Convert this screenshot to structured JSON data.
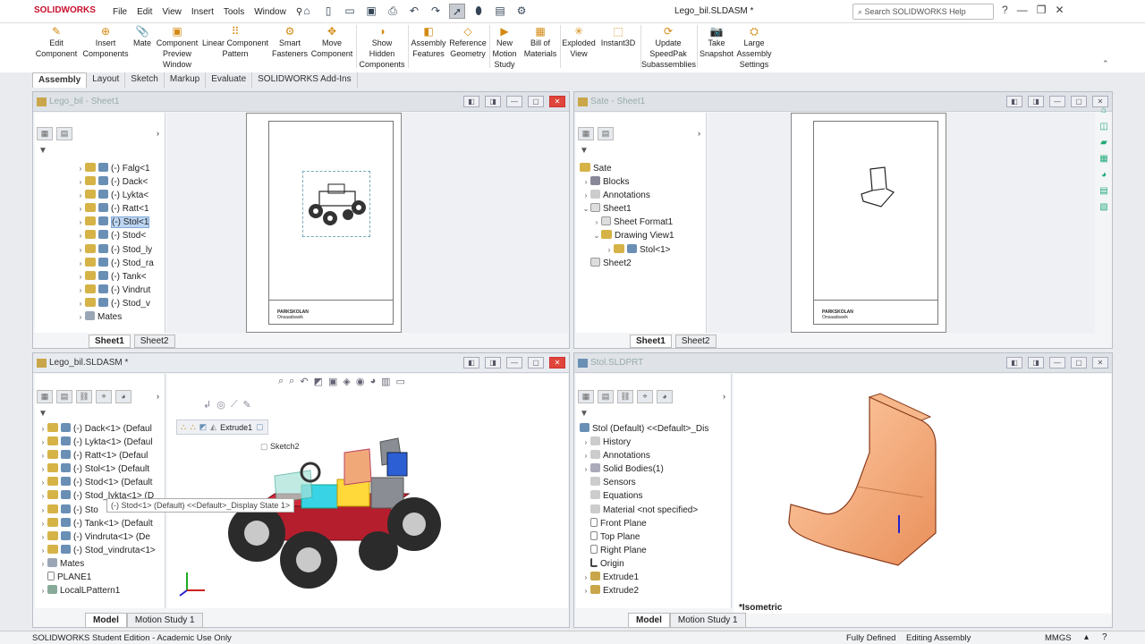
{
  "app": {
    "logo": "SOLIDWORKS",
    "doc_title": "Lego_bil.SLDASM *",
    "search_placeholder": "Search SOLIDWORKS Help"
  },
  "menu": [
    "File",
    "Edit",
    "View",
    "Insert",
    "Tools",
    "Window"
  ],
  "ribbon": [
    {
      "label": "Edit\nComponent",
      "icon": "edit-component-icon"
    },
    {
      "label": "Insert\nComponents",
      "icon": "insert-components-icon"
    },
    {
      "label": "Mate",
      "icon": "mate-icon"
    },
    {
      "label": "Component\nPreview\nWindow",
      "icon": "component-preview-icon"
    },
    {
      "label": "Linear Component\nPattern",
      "icon": "linear-pattern-icon"
    },
    {
      "label": "Smart\nFasteners",
      "icon": "smart-fasteners-icon"
    },
    {
      "label": "Move\nComponent",
      "icon": "move-component-icon"
    },
    {
      "label": "Show\nHidden\nComponents",
      "icon": "show-hidden-icon"
    },
    {
      "label": "Assembly\nFeatures",
      "icon": "assembly-features-icon"
    },
    {
      "label": "Reference\nGeometry",
      "icon": "reference-geometry-icon"
    },
    {
      "label": "New\nMotion\nStudy",
      "icon": "motion-study-icon"
    },
    {
      "label": "Bill of\nMaterials",
      "icon": "bill-of-materials-icon"
    },
    {
      "label": "Exploded\nView",
      "icon": "exploded-view-icon"
    },
    {
      "label": "Instant3D",
      "icon": "instant3d-icon"
    },
    {
      "label": "Update\nSpeedPak\nSubassemblies",
      "icon": "speedpak-icon"
    },
    {
      "label": "Take\nSnapshot",
      "icon": "snapshot-icon"
    },
    {
      "label": "Large\nAssembly\nSettings",
      "icon": "large-assembly-icon"
    }
  ],
  "tabs": [
    "Assembly",
    "Layout",
    "Sketch",
    "Markup",
    "Evaluate",
    "SOLIDWORKS Add-Ins"
  ],
  "win1": {
    "title": "Lego_bil - Sheet1",
    "tree": [
      "(-) Falg<1",
      "(-) Dack<",
      "(-) Lykta<",
      "(-) Ratt<1",
      "(-) Stol<1",
      "(-) Stod<",
      "(-) Stod_ly",
      "(-) Stod_ra",
      "(-) Tank<",
      "(-) Vindrut",
      "(-) Stod_v",
      "Mates"
    ],
    "sheets": [
      "Sheet1",
      "Sheet2"
    ],
    "tb_school": "PARKSKOLAN",
    "tb_sub": "Onsaadsavik"
  },
  "win2": {
    "title": "Sate - Sheet1",
    "tree": [
      "Sate",
      "Blocks",
      "Annotations",
      "Sheet1",
      "Sheet Format1",
      "Drawing View1",
      "Stol<1>",
      "Sheet2"
    ],
    "sheets": [
      "Sheet1",
      "Sheet2"
    ],
    "tb_school": "PARKSKOLAN",
    "tb_sub": "Onsaadsavik"
  },
  "win3": {
    "title": "Lego_bil.SLDASM *",
    "tree": [
      "(-) Dack<1> (Defaul",
      "(-) Lykta<1> (Defaul",
      "(-) Ratt<1> (Defaul",
      "(-) Stol<1> (Default",
      "(-) Stod<1> (Default",
      "(-) Stod_lykta<1> (D",
      "(-) Sto",
      "(-) Tank<1> (Default",
      "(-) Vindruta<1> (De",
      "(-) Stod_vindruta<1>",
      "Mates",
      "PLANE1",
      "LocalLPattern1"
    ],
    "tooltip": "(-) Stod<1> (Default) <<Default>_Display State 1>",
    "breadcrumb": "Extrude1",
    "sketch": "Sketch2",
    "tabs": [
      "Model",
      "Motion Study 1"
    ]
  },
  "win4": {
    "title": "Stol.SLDPRT",
    "tree": [
      "Stol (Default) <<Default>_Dis",
      "History",
      "Annotations",
      "Solid Bodies(1)",
      "Sensors",
      "Equations",
      "Material <not specified>",
      "Front Plane",
      "Top Plane",
      "Right Plane",
      "Origin",
      "Extrude1",
      "Extrude2"
    ],
    "view_label": "*Isometric",
    "tabs": [
      "Model",
      "Motion Study 1"
    ]
  },
  "status": {
    "left": "SOLIDWORKS Student Edition - Academic Use Only",
    "defined": "Fully Defined",
    "mode": "Editing Assembly",
    "units": "MMGS"
  },
  "colors": {
    "accent": "#c8102e",
    "seat": "#f0a878",
    "selection": "#bcd6f2"
  }
}
